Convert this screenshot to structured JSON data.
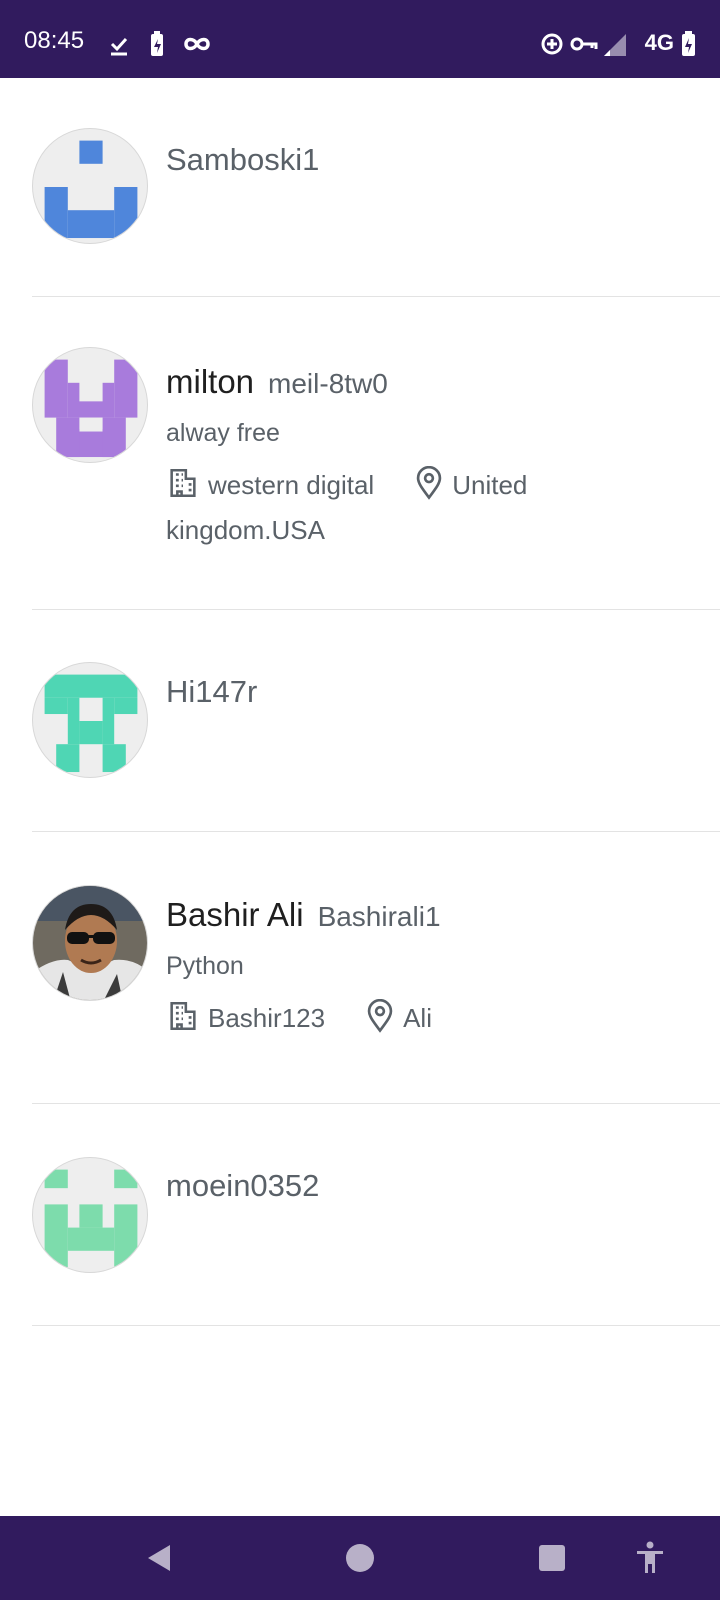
{
  "status_bar": {
    "time": "08:45",
    "network": "4G",
    "left_icons": [
      "download-done-icon",
      "battery-saver-icon",
      "infinity-icon"
    ],
    "right_icons": [
      "data-saver-icon",
      "vpn-key-icon",
      "signal-icon",
      "battery-charging-icon"
    ]
  },
  "users": [
    {
      "name": "",
      "login": "Samboski1",
      "bio": "",
      "company": "",
      "location": "",
      "avatar_color": "#4f86db"
    },
    {
      "name": "milton",
      "login": "meil-8tw0",
      "bio": "alway free",
      "company": "western digital",
      "location": "United kingdom.USA",
      "avatar_color": "#a87bdc"
    },
    {
      "name": "",
      "login": "Hi147r",
      "bio": "",
      "company": "",
      "location": "",
      "avatar_color": "#4fd6b4"
    },
    {
      "name": "Bashir Ali",
      "login": "Bashirali1",
      "bio": "Python",
      "company": "Bashir123",
      "location": "Ali",
      "avatar_color": "#8a8a8a"
    },
    {
      "name": "",
      "login": "moein0352",
      "bio": "",
      "company": "",
      "location": "",
      "avatar_color": "#7ddcac"
    }
  ],
  "nav_bar": {
    "buttons": [
      "back-icon",
      "home-icon",
      "recents-icon",
      "accessibility-icon"
    ]
  }
}
